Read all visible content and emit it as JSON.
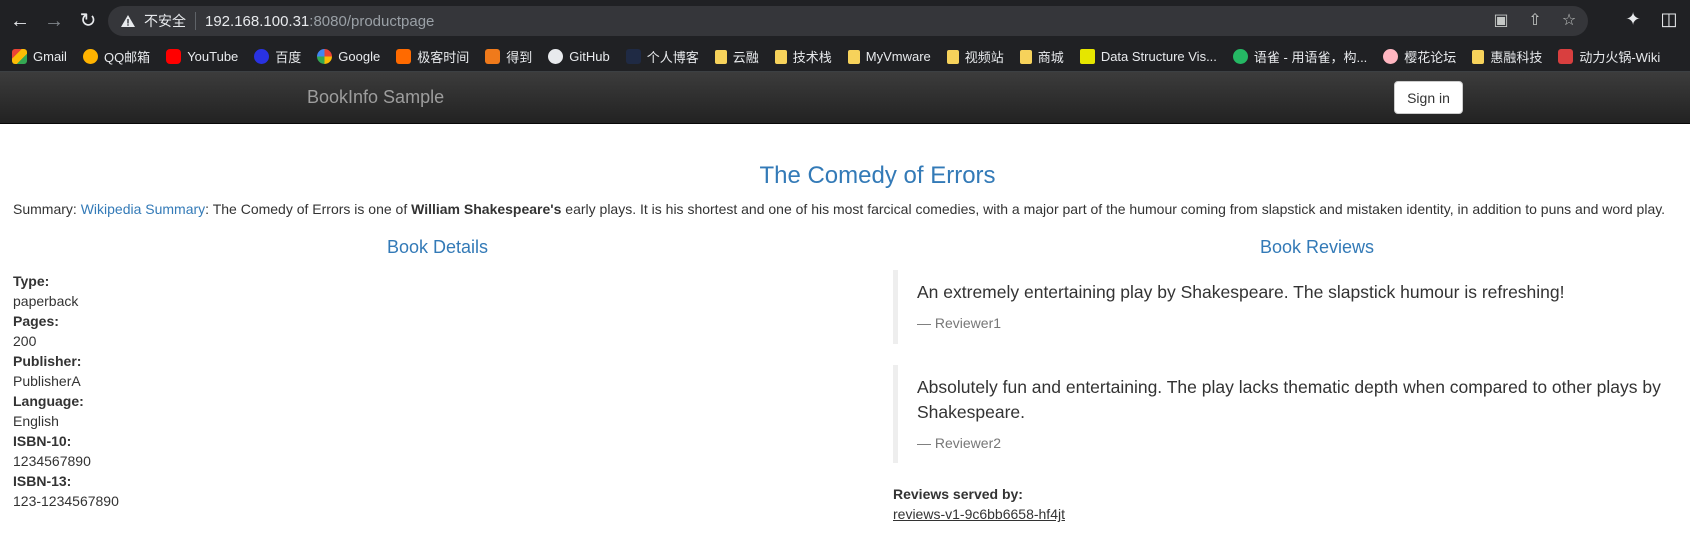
{
  "browser": {
    "not_secure": "不安全",
    "url_host": "192.168.100.31",
    "url_rest": ":8080/productpage",
    "bookmarks": [
      {
        "label": "Gmail",
        "icon": "gmail"
      },
      {
        "label": "QQ邮箱",
        "icon": "qq"
      },
      {
        "label": "YouTube",
        "icon": "yt"
      },
      {
        "label": "百度",
        "icon": "baidu"
      },
      {
        "label": "Google",
        "icon": "google"
      },
      {
        "label": "极客时间",
        "icon": "geek"
      },
      {
        "label": "得到",
        "icon": "dedao"
      },
      {
        "label": "GitHub",
        "icon": "gh"
      },
      {
        "label": "个人博客",
        "icon": "blog"
      },
      {
        "label": "云融",
        "icon": "folder"
      },
      {
        "label": "技术栈",
        "icon": "folder"
      },
      {
        "label": "MyVmware",
        "icon": "folder"
      },
      {
        "label": "视频站",
        "icon": "folder"
      },
      {
        "label": "商城",
        "icon": "folder"
      },
      {
        "label": "Data Structure Vis...",
        "icon": "usf"
      },
      {
        "label": "语雀 - 用语雀，构...",
        "icon": "yuque"
      },
      {
        "label": "樱花论坛",
        "icon": "sakura"
      },
      {
        "label": "惠融科技",
        "icon": "folder"
      },
      {
        "label": "动力火锅-Wiki",
        "icon": "dongli"
      }
    ]
  },
  "header": {
    "brand": "BookInfo Sample",
    "signin_label": "Sign in"
  },
  "book": {
    "title": "The Comedy of Errors",
    "summary_label": "Summary:",
    "summary_link": "Wikipedia Summary",
    "summary_pre": ": The Comedy of Errors is one of ",
    "summary_bold": "William Shakespeare's",
    "summary_post": " early plays. It is his shortest and one of his most farcical comedies, with a major part of the humour coming from slapstick and mistaken identity, in addition to puns and word play."
  },
  "details": {
    "title": "Book Details",
    "fields": [
      {
        "label": "Type:",
        "value": "paperback"
      },
      {
        "label": "Pages:",
        "value": "200"
      },
      {
        "label": "Publisher:",
        "value": "PublisherA"
      },
      {
        "label": "Language:",
        "value": "English"
      },
      {
        "label": "ISBN-10:",
        "value": "1234567890"
      },
      {
        "label": "ISBN-13:",
        "value": "123-1234567890"
      }
    ]
  },
  "reviews": {
    "title": "Book Reviews",
    "items": [
      {
        "text": "An extremely entertaining play by Shakespeare. The slapstick humour is refreshing!",
        "author": "— Reviewer1"
      },
      {
        "text": "Absolutely fun and entertaining. The play lacks thematic depth when compared to other plays by Shakespeare.",
        "author": "— Reviewer2"
      }
    ],
    "served_label": "Reviews served by:",
    "served_pod": "reviews-v1-9c6bb6658-hf4jt"
  }
}
